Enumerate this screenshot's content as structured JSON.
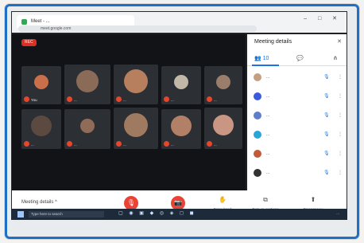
{
  "browser": {
    "tab_title": "Meet - ...",
    "address": "meet.google.com",
    "window_controls": "–  □  ✕"
  },
  "meeting": {
    "rec_label": "REC",
    "panel_title": "Meeting details",
    "panel_close": "✕",
    "tabs": {
      "people": "👥 10",
      "chat": "💬",
      "activities": "⋔"
    },
    "tiles": [
      {
        "name": "You",
        "color": "#c96f4a"
      },
      {
        "name": "...",
        "color": "#8a6b58"
      },
      {
        "name": "...",
        "color": "#b77f5e"
      },
      {
        "name": "...",
        "color": "#c2b8a8"
      },
      {
        "name": "...",
        "color": "#9a7d6b"
      },
      {
        "name": "...",
        "color": "#5c4a40"
      },
      {
        "name": "...",
        "color": "#8f6c58"
      },
      {
        "name": "...",
        "color": "#a07a60"
      },
      {
        "name": "...",
        "color": "#b28067"
      },
      {
        "name": "...",
        "color": "#c99684"
      }
    ],
    "people": [
      {
        "name": "...",
        "color": "#c4a083"
      },
      {
        "name": "...",
        "color": "#3b5bdb"
      },
      {
        "name": "...",
        "color": "#5f7ec9"
      },
      {
        "name": "...",
        "color": "#2aa6d6"
      },
      {
        "name": "...",
        "color": "#c25b3a"
      },
      {
        "name": "...",
        "color": "#333333"
      }
    ],
    "mute_icon": "🎙",
    "more_icon": "⋮"
  },
  "controls": {
    "meeting_name": "Meeting details ^",
    "mic": "🎙",
    "hangup": "📞",
    "cam": "📷",
    "raise_label": "Raise hand",
    "raise_icon": "✋",
    "captions_label": "Turn on captions",
    "captions_icon": "⧉",
    "present_label": "Present now",
    "present_icon": "⬆"
  },
  "taskbar": {
    "search": "Type here to search",
    "icons": "▢ ◉ ▣ ◆ ◎ ◈ ◻ ◼",
    "clock": "..."
  }
}
